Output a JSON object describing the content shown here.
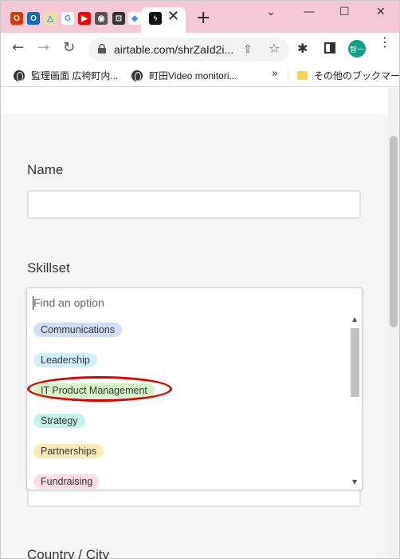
{
  "browser": {
    "tab_icons": [
      {
        "name": "office-icon",
        "color": "#d83b01",
        "glyph": "O"
      },
      {
        "name": "outlook-icon",
        "color": "#0f6cbd",
        "glyph": "O"
      },
      {
        "name": "drive-icon",
        "color": "#e8e0a0",
        "glyph": "△"
      },
      {
        "name": "google-icon",
        "color": "#ffffff",
        "glyph": "G"
      },
      {
        "name": "youtube-icon",
        "color": "#ff0000",
        "glyph": "▶"
      },
      {
        "name": "globe-tab-icon",
        "color": "#555555",
        "glyph": "◉"
      },
      {
        "name": "app-tab-icon",
        "color": "#333333",
        "glyph": "⊡"
      },
      {
        "name": "airtable-tab-icon",
        "color": "#ffffff",
        "glyph": "◆"
      },
      {
        "name": "bolt-tab-icon",
        "color": "#111111",
        "glyph": "ϟ"
      }
    ],
    "url": "airtable.com/shrZaId2i...",
    "profile_initials": "智一",
    "bookmarks": [
      {
        "label": "監理画面 広袴町内..."
      },
      {
        "label": "町田Video monitori..."
      }
    ],
    "bookmark_folder": "その他のブックマーク"
  },
  "form": {
    "name_label": "Name",
    "skillset_label": "Skillset",
    "next_label": "Country / City",
    "search_placeholder": "Find an option",
    "options": [
      {
        "label": "Communications",
        "color": "#cfdffb"
      },
      {
        "label": "Leadership",
        "color": "#d0f0fc"
      },
      {
        "label": "IT Product Management",
        "color": "#d1f7c4"
      },
      {
        "label": "Strategy",
        "color": "#c2f5e9"
      },
      {
        "label": "Partnerships",
        "color": "#ffeab6"
      },
      {
        "label": "Fundraising",
        "color": "#ffdce5"
      }
    ]
  }
}
